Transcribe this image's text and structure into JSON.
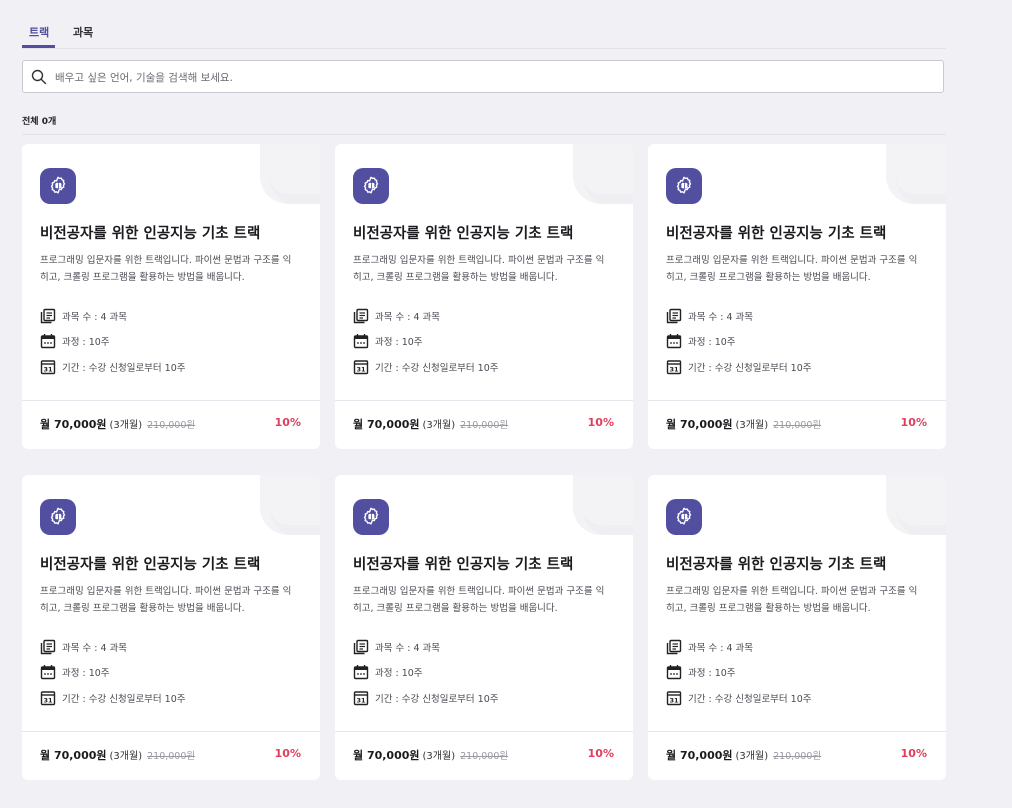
{
  "tabs": [
    {
      "label": "트랙",
      "active": true
    },
    {
      "label": "과목",
      "active": false
    }
  ],
  "search": {
    "placeholder": "배우고 싶은 언어, 기술을 검색해 보세요.",
    "value": ""
  },
  "count_label": "전체 0개",
  "colors": {
    "accent": "#524fa1",
    "discount": "#e03e5c",
    "background": "#f1f1f5"
  },
  "cards": [
    {
      "icon": "gear-brain-icon",
      "title": "비전공자를 위한 인공지능 기초 트랙",
      "description": "프로그래밍 입문자를 위한 트랙입니다. 파이썬 문법과 구조를 익히고, 크롤링 프로그램을 활용하는 방법을 배웁니다.",
      "courses": "과목 수 : 4 과목",
      "duration": "과정 : 10주",
      "period": "기간 : 수강 신청일로부터 10주",
      "price": "월 70,000원",
      "price_period": "(3개월)",
      "original_price": "210,000원",
      "discount": "10%"
    },
    {
      "icon": "gear-brain-icon",
      "title": "비전공자를 위한 인공지능 기초 트랙",
      "description": "프로그래밍 입문자를 위한 트랙입니다. 파이썬 문법과 구조를 익히고, 크롤링 프로그램을 활용하는 방법을 배웁니다.",
      "courses": "과목 수 : 4 과목",
      "duration": "과정 : 10주",
      "period": "기간 : 수강 신청일로부터 10주",
      "price": "월 70,000원",
      "price_period": "(3개월)",
      "original_price": "210,000원",
      "discount": "10%"
    },
    {
      "icon": "gear-brain-icon",
      "title": "비전공자를 위한 인공지능 기초 트랙",
      "description": "프로그래밍 입문자를 위한 트랙입니다. 파이썬 문법과 구조를 익히고, 크롤링 프로그램을 활용하는 방법을 배웁니다.",
      "courses": "과목 수 : 4 과목",
      "duration": "과정 : 10주",
      "period": "기간 : 수강 신청일로부터 10주",
      "price": "월 70,000원",
      "price_period": "(3개월)",
      "original_price": "210,000원",
      "discount": "10%"
    },
    {
      "icon": "gear-brain-icon",
      "title": "비전공자를 위한 인공지능 기초 트랙",
      "description": "프로그래밍 입문자를 위한 트랙입니다. 파이썬 문법과 구조를 익히고, 크롤링 프로그램을 활용하는 방법을 배웁니다.",
      "courses": "과목 수 : 4 과목",
      "duration": "과정 : 10주",
      "period": "기간 : 수강 신청일로부터 10주",
      "price": "월 70,000원",
      "price_period": "(3개월)",
      "original_price": "210,000원",
      "discount": "10%"
    },
    {
      "icon": "gear-brain-icon",
      "title": "비전공자를 위한 인공지능 기초 트랙",
      "description": "프로그래밍 입문자를 위한 트랙입니다. 파이썬 문법과 구조를 익히고, 크롤링 프로그램을 활용하는 방법을 배웁니다.",
      "courses": "과목 수 : 4 과목",
      "duration": "과정 : 10주",
      "period": "기간 : 수강 신청일로부터 10주",
      "price": "월 70,000원",
      "price_period": "(3개월)",
      "original_price": "210,000원",
      "discount": "10%"
    },
    {
      "icon": "gear-brain-icon",
      "title": "비전공자를 위한 인공지능 기초 트랙",
      "description": "프로그래밍 입문자를 위한 트랙입니다. 파이썬 문법과 구조를 익히고, 크롤링 프로그램을 활용하는 방법을 배웁니다.",
      "courses": "과목 수 : 4 과목",
      "duration": "과정 : 10주",
      "period": "기간 : 수강 신청일로부터 10주",
      "price": "월 70,000원",
      "price_period": "(3개월)",
      "original_price": "210,000원",
      "discount": "10%"
    }
  ]
}
